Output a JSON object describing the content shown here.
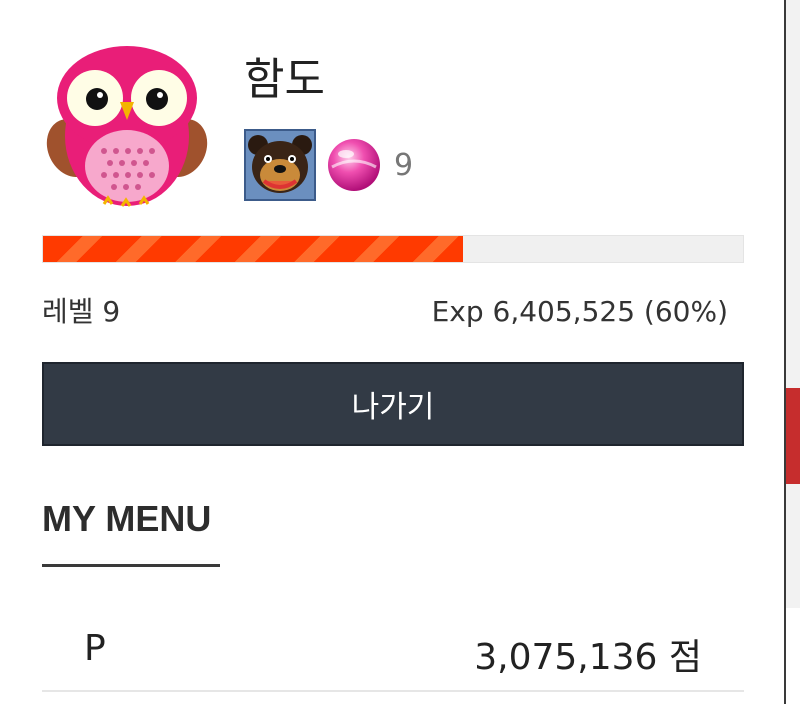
{
  "profile": {
    "username": "함도",
    "gem_count": "9",
    "icons": {
      "avatar": "pink-owl-avatar",
      "badge": "dog-face-badge",
      "gem": "pink-candy-gem"
    }
  },
  "experience": {
    "level_label": "레벨 9",
    "exp_text": "Exp 6,405,525 (60%)",
    "progress_fraction": 0.6,
    "bar_color": "#ff3a00",
    "track_color": "#f0f0f0"
  },
  "actions": {
    "exit_label": "나가기",
    "exit_bg": "#323a45"
  },
  "menu": {
    "title": "MY MENU",
    "points_label": "P",
    "points_value": "3,075,136 점"
  }
}
